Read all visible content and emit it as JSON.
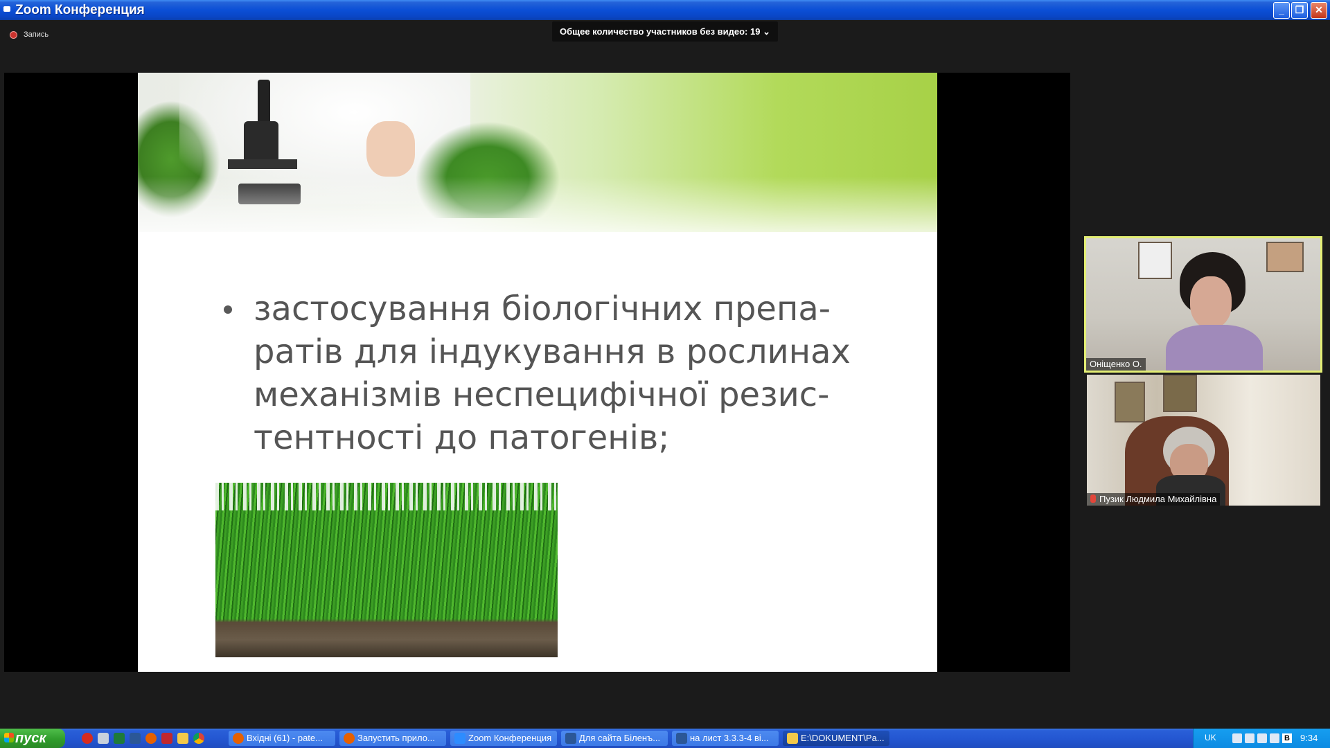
{
  "window": {
    "title": "Zoom Конференция",
    "min_glyph": "_",
    "max_glyph": "❐",
    "close_glyph": "✕"
  },
  "recording": {
    "label": "Запись"
  },
  "participants_banner": "Общее количество участников без видео: 19 ⌄",
  "slide": {
    "bullet": [
      "застосування біологічних препа-",
      "ратів для індукування в рослинах",
      "механізмів неспецифічної резис-",
      "тентності до патогенів;"
    ]
  },
  "videos": [
    {
      "name": "Оніщенко О.",
      "active_speaker": true
    },
    {
      "name": "Пузик  Людмила Михайлівна",
      "muted": true
    }
  ],
  "taskbar": {
    "start": "пуск",
    "tasks": [
      "Вхідні (61) - pate...",
      "Запустить прило...",
      "Zoom Конференция",
      "Для сайта Біленъ...",
      "на лист 3.3.3-4 ві...",
      "E:\\DOKUMENT\\Pa..."
    ],
    "language": "UK",
    "tray_b": "B",
    "clock": "9:34"
  },
  "colors": {
    "active_speaker_border": "#e3ee74",
    "titlebar": "#0b4fd6",
    "start_button": "#2e9a2a"
  }
}
